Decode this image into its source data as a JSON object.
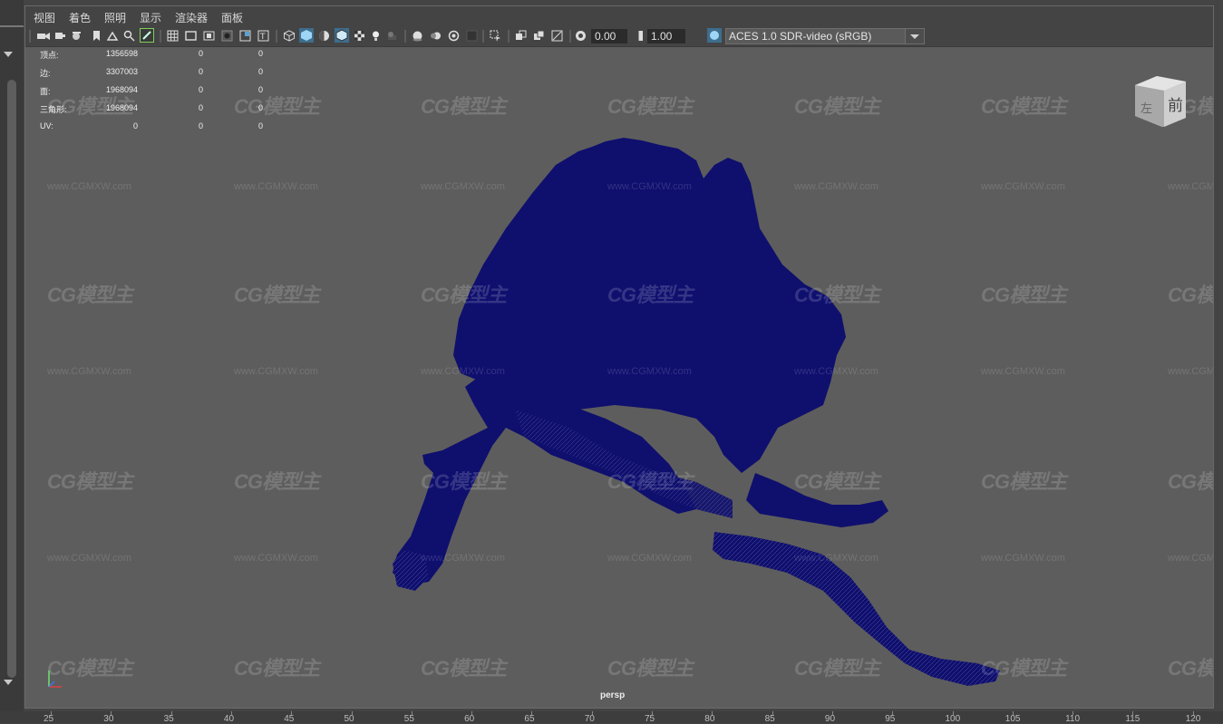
{
  "menubar": {
    "items": [
      "视图",
      "着色",
      "照明",
      "显示",
      "渲染器",
      "面板"
    ]
  },
  "toolbar": {
    "icons": [
      "select-camera-icon",
      "camera-attributes-icon",
      "bookmark-icon",
      "image-plane-icon",
      "2d-pan-zoom-icon",
      "grease-pencil-icon",
      "grid-icon",
      "film-gate-icon",
      "resolution-gate-icon",
      "gate-mask-icon",
      "field-chart-icon",
      "safe-action-icon",
      "safe-title-icon",
      "wireframe-icon",
      "smooth-shade-icon",
      "default-material-icon",
      "wireframe-on-shaded-icon",
      "textured-icon",
      "use-all-lights-icon",
      "shadows-icon",
      "screen-space-ao-icon",
      "motion-blur-icon",
      "multisample-aa-icon",
      "depth-of-field-icon",
      "isolate-select-icon",
      "xray-icon",
      "xray-active-icon",
      "xray-joints-icon",
      "exposure-icon",
      "gamma-icon",
      "color-management-icon"
    ],
    "exposure_value": "0.00",
    "gamma_value": "1.00",
    "color_space": "ACES 1.0 SDR-video (sRGB)"
  },
  "hud": {
    "rows": [
      {
        "label": "顶点:",
        "v1": "1356598",
        "v2": "0",
        "v3": "0"
      },
      {
        "label": "边:",
        "v1": "3307003",
        "v2": "0",
        "v3": "0"
      },
      {
        "label": "面:",
        "v1": "1968094",
        "v2": "0",
        "v3": "0"
      },
      {
        "label": "三角形:",
        "v1": "1968094",
        "v2": "0",
        "v3": "0"
      },
      {
        "label": "UV:",
        "v1": "0",
        "v2": "0",
        "v3": "0"
      }
    ]
  },
  "viewport": {
    "camera_name": "persp",
    "viewcube": {
      "left_face": "左",
      "front_face": "前"
    },
    "mesh_color": "#0f0f6e",
    "background_color": "#5d5d5d"
  },
  "watermark": {
    "logo_text": "CG模型主",
    "url_text": "www.CGMXW.com"
  },
  "timeline": {
    "ticks": [
      "25",
      "30",
      "35",
      "40",
      "45",
      "50",
      "55",
      "60",
      "65",
      "70",
      "75",
      "80",
      "85",
      "90",
      "95",
      "100",
      "105",
      "110",
      "115",
      "120"
    ]
  }
}
